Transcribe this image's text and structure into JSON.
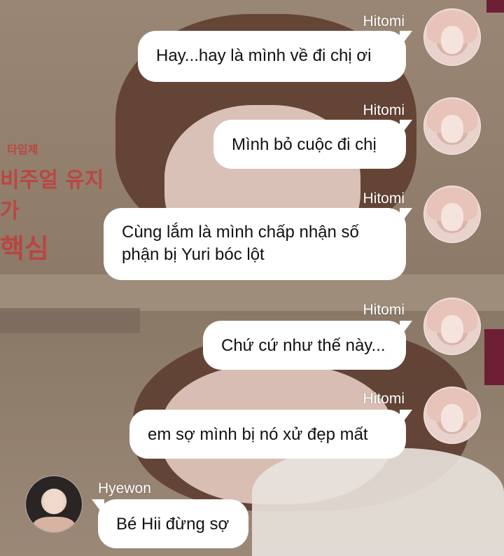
{
  "messages": [
    {
      "sender": "Hitomi",
      "text": "Hay...hay là mình về đi chị ơi"
    },
    {
      "sender": "Hitomi",
      "text": "Mình bỏ cuộc đi chị"
    },
    {
      "sender": "Hitomi",
      "lines": [
        "Cùng lắm là mình chấp nhận số",
        "phận bị Yuri bóc lột"
      ]
    },
    {
      "sender": "Hitomi",
      "text": "Chứ cứ như thế này..."
    },
    {
      "sender": "Hitomi",
      "text": "em sợ mình bị nó xử đẹp mất"
    },
    {
      "sender": "Hyewon",
      "text": "Bé Hii đừng sợ"
    }
  ],
  "background_text": {
    "line1": "타입제",
    "line2": "비주얼 유지가",
    "line3": "핵심"
  },
  "colors": {
    "bubble": "#ffffff",
    "name_text": "#ffffff",
    "sign_red": "#c23a3a"
  }
}
